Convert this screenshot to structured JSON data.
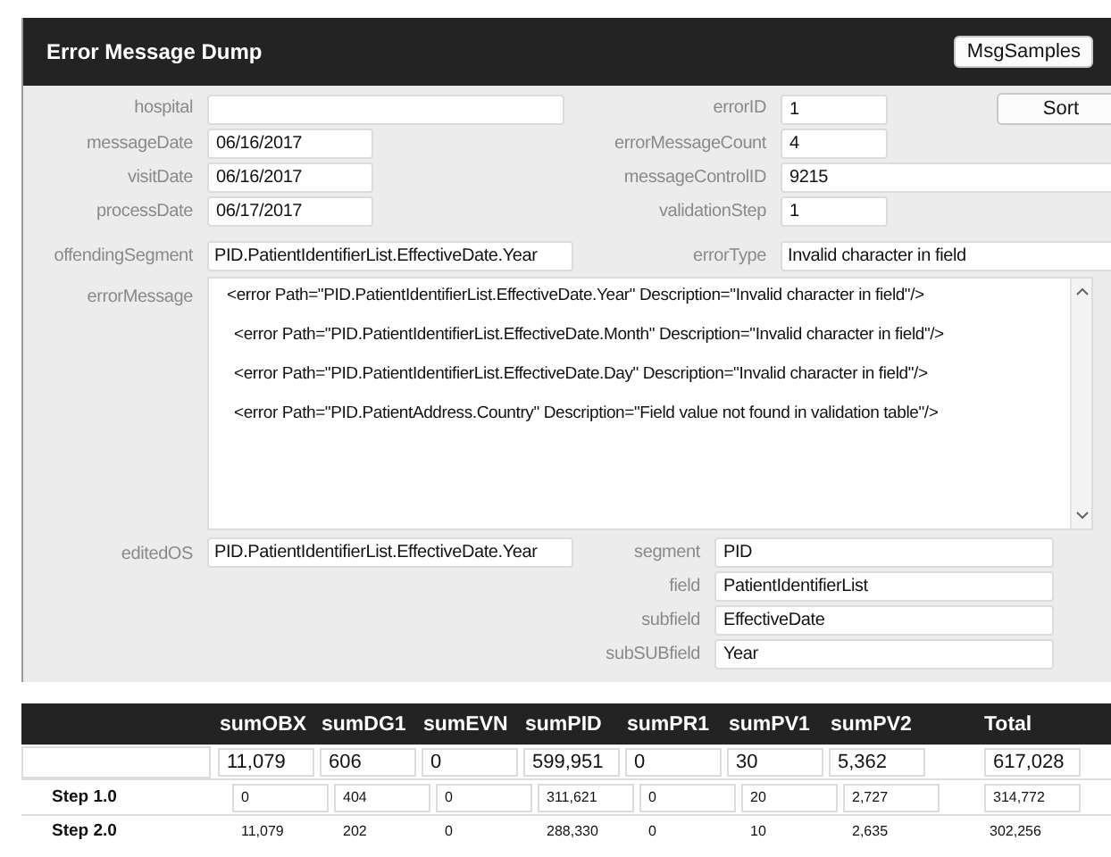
{
  "window": {
    "title": "Error Message Dump"
  },
  "header_button": "MsgSamples",
  "sort_button": "Sort",
  "top_rows": [
    {
      "left": {
        "label": "hospital"
      },
      "right": {
        "label": "errorID",
        "value": "1"
      }
    },
    {
      "left": {
        "label": "messageDate",
        "value": "06/16/2017"
      },
      "right": {
        "label": "errorMessageCount",
        "value": "4"
      }
    },
    {
      "left": {
        "label": "visitDate",
        "value": "06/16/2017"
      },
      "right": {
        "label": "messageControlID",
        "value": "9215"
      }
    },
    {
      "left": {
        "label": "processDate",
        "value": "06/17/2017"
      },
      "right": {
        "label": "validationStep",
        "value": "1"
      }
    }
  ],
  "offending_segment": {
    "label": "offendingSegment",
    "value": "PID.PatientIdentifierList.EffectiveDate.Year"
  },
  "error_type": {
    "label": "errorType",
    "value": "Invalid character in field"
  },
  "error_message": {
    "label": "errorMessage",
    "lines": [
      "<error Path=\"PID.PatientIdentifierList.EffectiveDate.Year\" Description=\"Invalid character in field\"/>",
      "<error Path=\"PID.PatientIdentifierList.EffectiveDate.Month\" Description=\"Invalid character in field\"/>",
      "<error Path=\"PID.PatientIdentifierList.EffectiveDate.Day\" Description=\"Invalid character in field\"/>",
      "<error Path=\"PID.PatientAddress.Country\" Description=\"Field value not found in validation table\"/>"
    ]
  },
  "edited_os": {
    "label": "editedOS",
    "value": "PID.PatientIdentifierList.EffectiveDate.Year"
  },
  "segment_fields": [
    {
      "label": "segment",
      "value": "PID"
    },
    {
      "label": "field",
      "value": "PatientIdentifierList"
    },
    {
      "label": "subfield",
      "value": "EffectiveDate"
    },
    {
      "label": "subSUBfield",
      "value": "Year"
    }
  ],
  "table": {
    "columns": [
      "sumOBX",
      "sumDG1",
      "sumEVN",
      "sumPID",
      "sumPR1",
      "sumPV1",
      "sumPV2",
      "Total"
    ],
    "rows": [
      {
        "kind": "total",
        "cells": [
          "11,079",
          "606",
          "0",
          "599,951",
          "0",
          "30",
          "5,362",
          "617,028"
        ]
      },
      {
        "kind": "boxed",
        "label": "Step 1.0",
        "cells": [
          "0",
          "404",
          "0",
          "311,621",
          "0",
          "20",
          "2,727",
          "314,772"
        ]
      },
      {
        "kind": "plain",
        "label": "Step 2.0",
        "cells": [
          "11,079",
          "202",
          "0",
          "288,330",
          "0",
          "10",
          "2,635",
          "302,256"
        ]
      }
    ]
  }
}
